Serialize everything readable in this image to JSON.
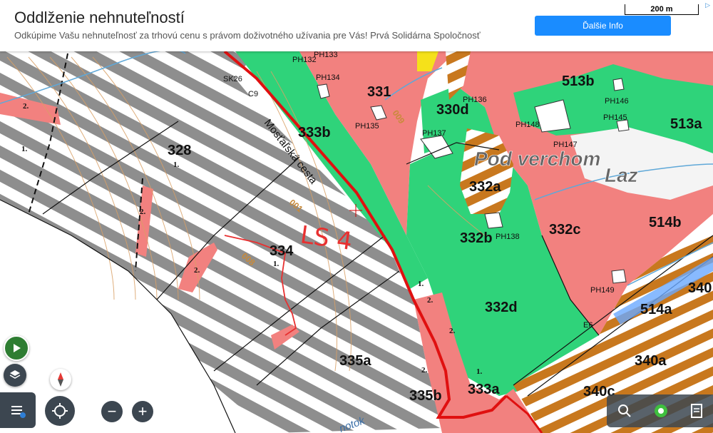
{
  "ad": {
    "title": "Oddlženie nehnuteľností",
    "text": "Odkúpime Vašu nehnuteľnosť za trhovú cenu s právom doživotného užívania pre Vás! Prvá Solidárna Spoločnosť",
    "button": "Ďalšie Info"
  },
  "scale_label": "200 m",
  "parcels": [
    "328",
    "334",
    "333b",
    "331",
    "330d",
    "332a",
    "332b",
    "332c",
    "332d",
    "333a",
    "335a",
    "335b",
    "340a",
    "340c",
    "513b",
    "513a",
    "514b",
    "514a",
    "340"
  ],
  "small_labels": [
    "PH133",
    "PH132",
    "PH134",
    "PH135",
    "PH136",
    "PH137",
    "PH138",
    "PH146",
    "PH145",
    "PH148",
    "PH147",
    "PH149",
    "SK26",
    "C9",
    "E6"
  ],
  "place_names": [
    "Pod verchom",
    "Laz"
  ],
  "road_name": "Mosťaľská cesta",
  "handwritten": "LS 4",
  "contour_labels": [
    "001",
    "009",
    "008"
  ],
  "stream_label": "notok",
  "class_marks": [
    "1.",
    "2."
  ],
  "colors": {
    "forest_green": "#2ecc71",
    "private_red": "#f08080",
    "road_red": "#e01010",
    "stripe_gray": "#8a8a8a",
    "stripe_orange": "#c87820"
  },
  "controls": {
    "zoom_in": "+",
    "zoom_out": "−"
  }
}
